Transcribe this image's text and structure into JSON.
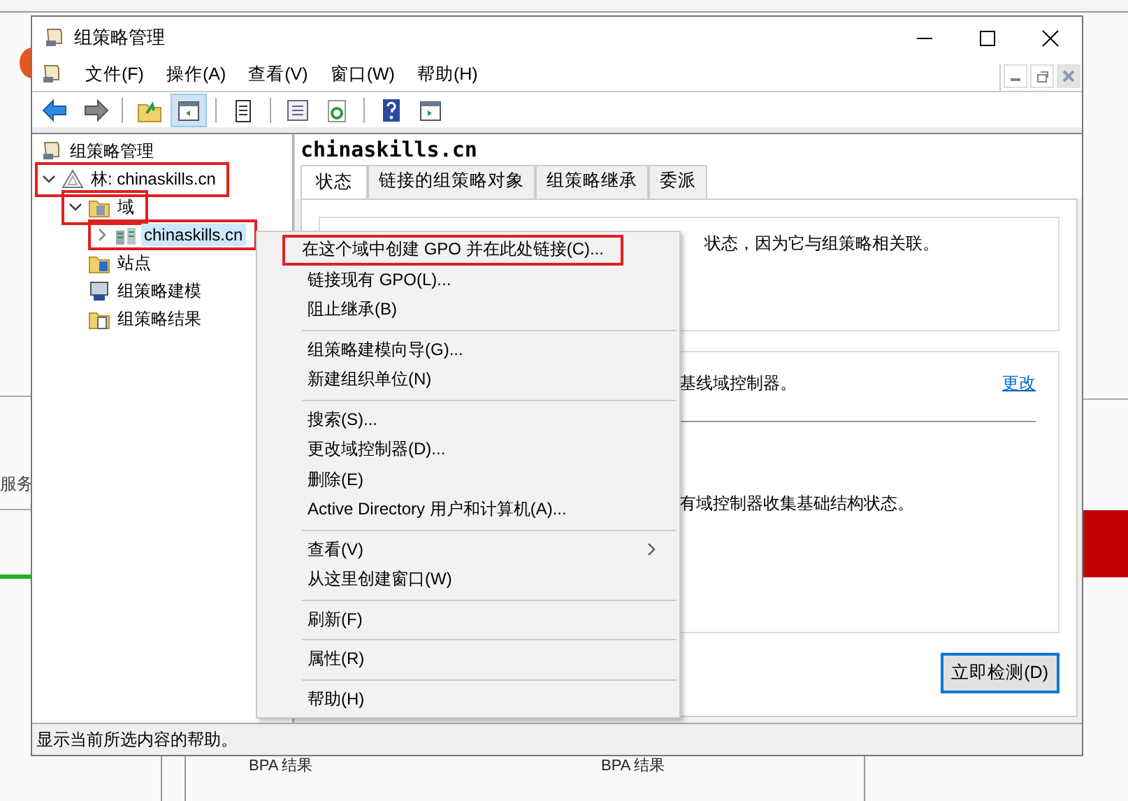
{
  "background": {
    "side_label": "服务",
    "bottom_labels": [
      "BPA 结果",
      "BPA 结果"
    ]
  },
  "window": {
    "title": "组策略管理"
  },
  "menu_bar": [
    "文件(F)",
    "操作(A)",
    "查看(V)",
    "窗口(W)",
    "帮助(H)"
  ],
  "toolbar": [
    {
      "kind": "back",
      "pressed": false
    },
    {
      "kind": "forward",
      "pressed": false
    },
    {
      "kind": "separator"
    },
    {
      "kind": "up",
      "pressed": false
    },
    {
      "kind": "tree-toggle",
      "pressed": true
    },
    {
      "kind": "separator"
    },
    {
      "kind": "clipboard",
      "pressed": false
    },
    {
      "kind": "separator"
    },
    {
      "kind": "export",
      "pressed": false
    },
    {
      "kind": "refresh",
      "pressed": false
    },
    {
      "kind": "separator"
    },
    {
      "kind": "help",
      "pressed": false
    },
    {
      "kind": "action-pane",
      "pressed": false
    }
  ],
  "tree": [
    {
      "label": "组策略管理",
      "kind": "root",
      "selected": false,
      "annotated": false,
      "children": [
        {
          "label": "林: chinaskills.cn",
          "kind": "forest",
          "expanded": true,
          "selected": false,
          "annotated": true,
          "children": [
            {
              "label": "域",
              "kind": "folder",
              "expanded": true,
              "selected": false,
              "annotated": true,
              "children": [
                {
                  "label": "chinaskills.cn",
                  "kind": "domain",
                  "expanded": false,
                  "selected": true,
                  "annotated": true
                }
              ]
            },
            {
              "label": "站点",
              "kind": "sites",
              "selected": false,
              "annotated": false
            },
            {
              "label": "组策略建模",
              "kind": "modeling",
              "selected": false,
              "annotated": false
            },
            {
              "label": "组策略结果",
              "kind": "results",
              "selected": false,
              "annotated": false
            }
          ]
        }
      ]
    }
  ],
  "details": {
    "heading": "chinaskills.cn",
    "tabs": [
      {
        "label": "状态",
        "selected": true
      },
      {
        "label": "链接的组策略对象",
        "selected": false
      },
      {
        "label": "组策略继承",
        "selected": false
      },
      {
        "label": "委派",
        "selected": false
      }
    ],
    "status_text": "状态，因为它与组策略相关联。",
    "baseline_text": "基线域控制器。",
    "change_link": "更改",
    "collect_text": "有域控制器收集基础结构状态。",
    "detect_button": "立即检测(D)"
  },
  "context_menu": [
    {
      "kind": "item",
      "label": "在这个域中创建 GPO 并在此处链接(C)...",
      "annotated": true
    },
    {
      "kind": "item",
      "label": "链接现有 GPO(L)...",
      "annotated": false
    },
    {
      "kind": "item",
      "label": "阻止继承(B)",
      "annotated": false
    },
    {
      "kind": "separator"
    },
    {
      "kind": "item",
      "label": "组策略建模向导(G)...",
      "annotated": false
    },
    {
      "kind": "item",
      "label": "新建组织单位(N)",
      "annotated": false
    },
    {
      "kind": "separator"
    },
    {
      "kind": "item",
      "label": "搜索(S)...",
      "annotated": false
    },
    {
      "kind": "item",
      "label": "更改域控制器(D)...",
      "annotated": false
    },
    {
      "kind": "item",
      "label": "删除(E)",
      "annotated": false
    },
    {
      "kind": "item",
      "label": "Active Directory 用户和计算机(A)...",
      "annotated": false
    },
    {
      "kind": "separator"
    },
    {
      "kind": "submenu",
      "label": "查看(V)",
      "annotated": false
    },
    {
      "kind": "item",
      "label": "从这里创建窗口(W)",
      "annotated": false
    },
    {
      "kind": "separator"
    },
    {
      "kind": "item",
      "label": "刷新(F)",
      "annotated": false
    },
    {
      "kind": "separator"
    },
    {
      "kind": "item",
      "label": "属性(R)",
      "annotated": false
    },
    {
      "kind": "separator"
    },
    {
      "kind": "item",
      "label": "帮助(H)",
      "annotated": false
    }
  ],
  "status_bar": "显示当前所选内容的帮助。"
}
